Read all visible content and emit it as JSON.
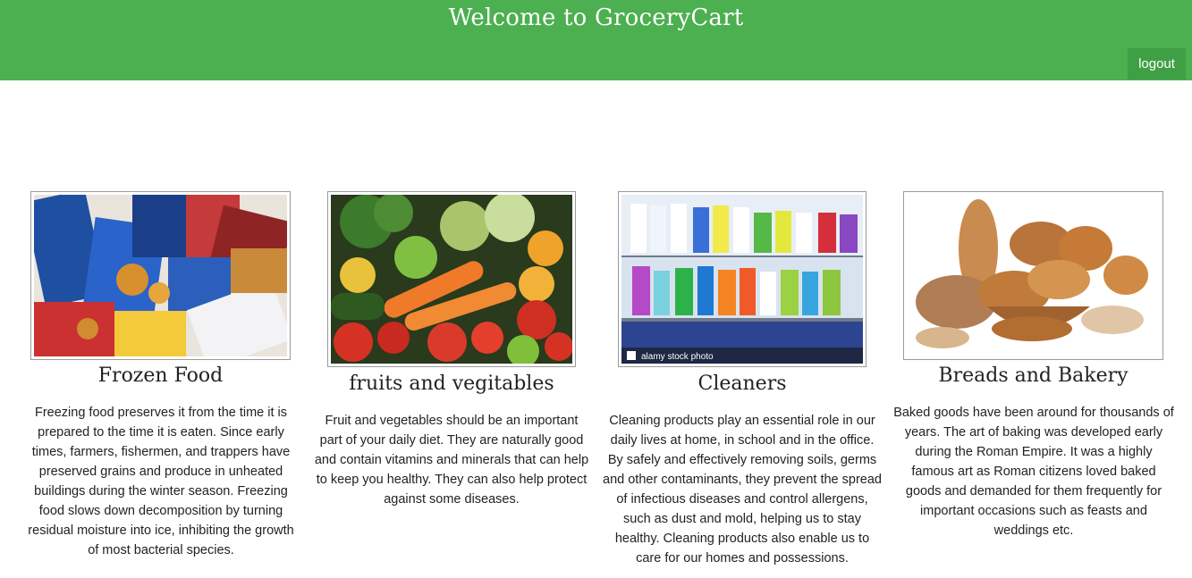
{
  "header": {
    "title": "Welcome to GroceryCart",
    "logout_label": "logout"
  },
  "categories": [
    {
      "title": "Frozen Food",
      "description": "Freezing food preserves it from the time it is prepared to the time it is eaten. Since early times, farmers, fishermen, and trappers have preserved grains and produce in unheated buildings during the winter season. Freezing food slows down decomposition by turning residual moisture into ice, inhibiting the growth of most bacterial species.",
      "image_icon": "frozen-food-image"
    },
    {
      "title": "fruits and vegitables",
      "description": "Fruit and vegetables should be an important part of your daily diet. They are naturally good and contain vitamins and minerals that can help to keep you healthy. They can also help protect against some diseases.",
      "image_icon": "fruits-vegetables-image"
    },
    {
      "title": "Cleaners",
      "description": "Cleaning products play an essential role in our daily lives at home, in school and in the office. By safely and effectively removing soils, germs and other contaminants, they prevent the spread of infectious diseases and control allergens, such as dust and mold, helping us to stay healthy. Cleaning products also enable us to care for our homes and possessions.",
      "image_icon": "cleaners-image",
      "image_watermark": "alamy stock photo"
    },
    {
      "title": "Breads and Bakery",
      "description": "Baked goods have been around for thousands of years. The art of baking was developed early during the Roman Empire. It was a highly famous art as Roman citizens loved baked goods and demanded for them frequently for important occasions such as feasts and weddings etc.",
      "image_icon": "bread-bakery-image"
    }
  ],
  "colors": {
    "header_bg": "#4caf50",
    "logout_bg": "#3f9f44",
    "text": "#222222"
  }
}
